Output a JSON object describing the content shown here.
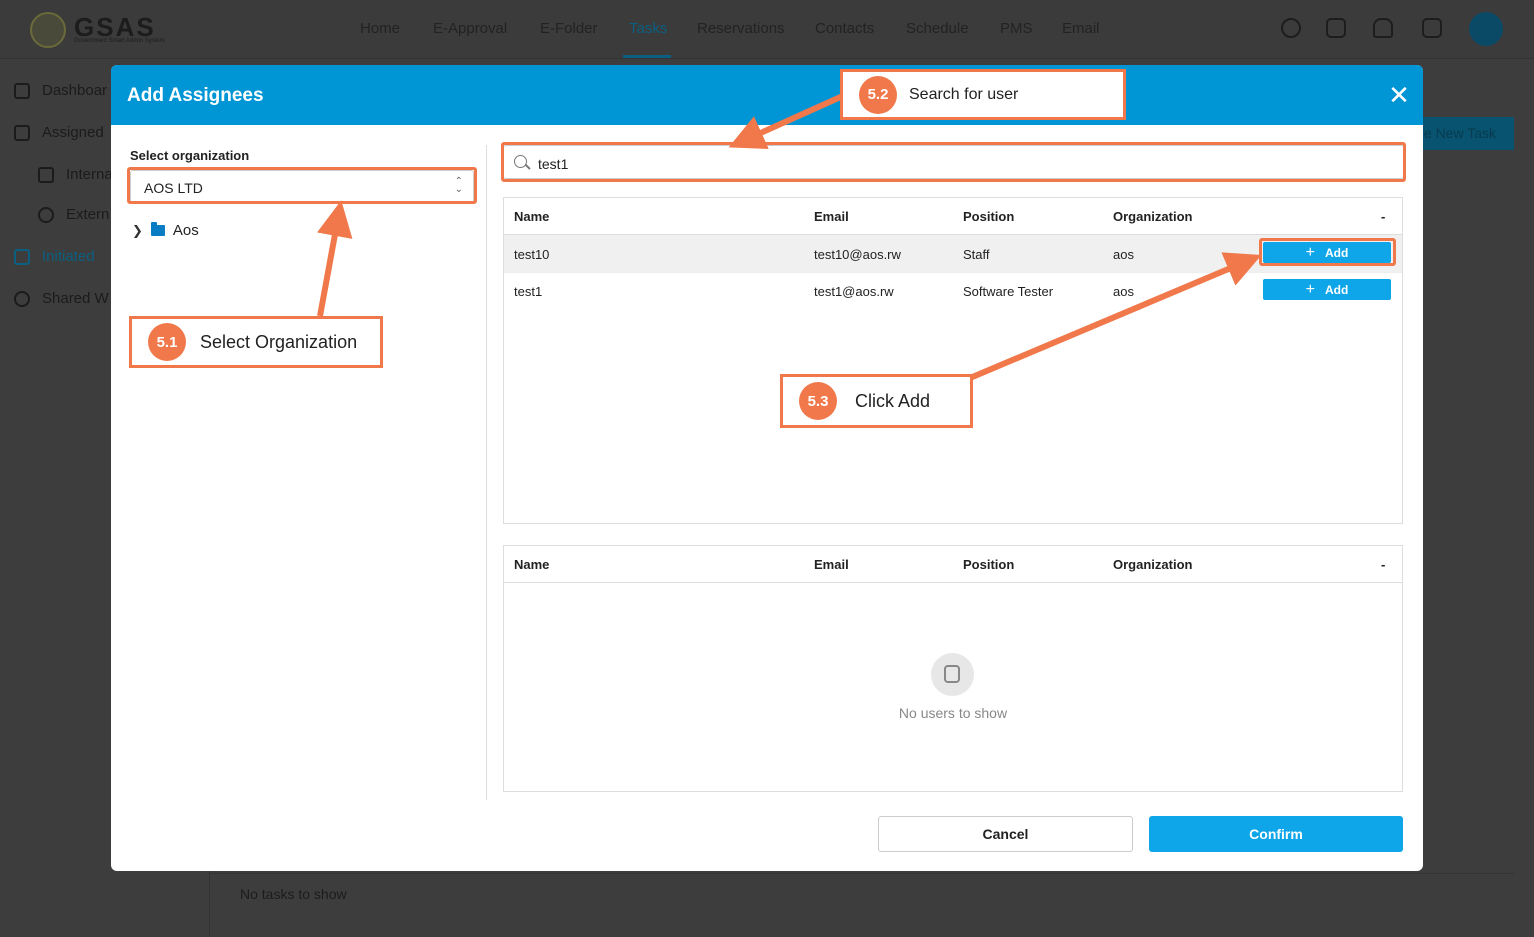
{
  "app": {
    "logo_text": "GSAS",
    "logo_subtitle": "Government Smart Admin System",
    "nav": [
      "Home",
      "E-Approval",
      "E-Folder",
      "Tasks",
      "Reservations",
      "Contacts",
      "Schedule",
      "PMS",
      "Email"
    ],
    "active_nav": "Tasks",
    "top_icons": [
      "help-icon",
      "apps-grid-icon",
      "bell-icon",
      "chat-icon",
      "user-avatar-icon"
    ],
    "sidebar": [
      "Dashboar",
      "Assigned",
      "Interna",
      "Extern",
      "Initiated",
      "Shared W"
    ],
    "new_task_label": "e New Task",
    "empty_tasks": "No tasks to show"
  },
  "modal": {
    "title": "Add Assignees",
    "org_label": "Select organization",
    "org_value": "AOS LTD",
    "tree_item": "Aos",
    "search_value": "test1",
    "columns": [
      "Name",
      "Email",
      "Position",
      "Organization",
      "-"
    ],
    "results": [
      {
        "name": "test10",
        "email": "test10@aos.rw",
        "position": "Staff",
        "organization": "aos",
        "action": "Add"
      },
      {
        "name": "test1",
        "email": "test1@aos.rw",
        "position": "Software Tester",
        "organization": "aos",
        "action": "Add"
      }
    ],
    "empty_selected": "No users to show",
    "cancel_label": "Cancel",
    "confirm_label": "Confirm"
  },
  "annotations": {
    "step1": {
      "badge": "5.1",
      "text": "Select Organization"
    },
    "step2": {
      "badge": "5.2",
      "text": "Search for user"
    },
    "step3": {
      "badge": "5.3",
      "text": "Click Add"
    }
  },
  "colors": {
    "modal_header": "#0096d5",
    "primary_button": "#0ea5e9",
    "annotation": "#f0784a",
    "overlay_bg": "#3d3d3d"
  }
}
